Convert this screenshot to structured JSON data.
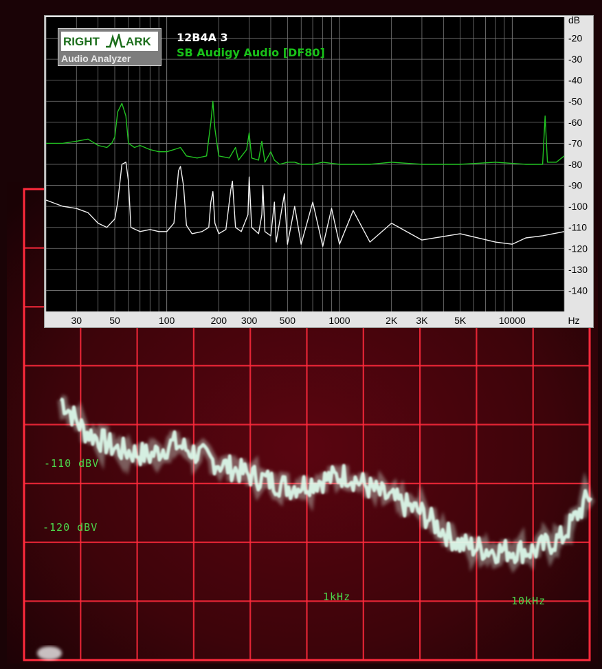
{
  "scope_overlay": {
    "labels": [
      {
        "text": "-110 dBV",
        "name": "scope-label-110dbv"
      },
      {
        "text": "-120 dBV",
        "name": "scope-label-120dbv"
      },
      {
        "text": "1kHz",
        "name": "scope-label-1khz"
      },
      {
        "text": "10kHz",
        "name": "scope-label-10khz"
      }
    ],
    "colors": {
      "background": "#3a0408",
      "grid": "#ff2a3c",
      "trace": "#dffff0",
      "label": "#4cd94c"
    }
  },
  "rmaa": {
    "logo": {
      "word1": "RIGHT",
      "word2": "ARK",
      "subtitle": "Audio Analyzer"
    },
    "title_line1": "12B4A 3",
    "title_line2": "SB Audigy Audio [DF80]",
    "colors": {
      "plot_bg": "#000000",
      "grid": "#7a7a7a",
      "series_green": "#22c422",
      "series_white": "#f0f0f0",
      "panel": "#e4e4e4"
    }
  },
  "chart_data": {
    "type": "line",
    "title": "12B4A 3",
    "subtitle": "SB Audigy Audio [DF80]",
    "xlabel": "Hz",
    "ylabel": "dB",
    "x_scale": "log",
    "xlim": [
      20,
      20000
    ],
    "ylim": [
      -150,
      -10
    ],
    "x_tick_labels": [
      "30",
      "50",
      "100",
      "200",
      "300",
      "500",
      "1000",
      "2K",
      "3K",
      "5K",
      "10000",
      "Hz"
    ],
    "x_tick_values": [
      30,
      50,
      100,
      200,
      300,
      500,
      1000,
      2000,
      3000,
      5000,
      10000
    ],
    "y_tick_labels": [
      "dB",
      "-20",
      "-30",
      "-40",
      "-50",
      "-60",
      "-70",
      "-80",
      "-90",
      "-100",
      "-110",
      "-120",
      "-130",
      "-140"
    ],
    "y_tick_values": [
      -20,
      -30,
      -40,
      -50,
      -60,
      -70,
      -80,
      -90,
      -100,
      -110,
      -120,
      -130,
      -140
    ],
    "grid": true,
    "series": [
      {
        "name": "SB Audigy Audio [DF80]",
        "color": "#22c422",
        "points": [
          [
            20,
            -70
          ],
          [
            25,
            -70
          ],
          [
            30,
            -69
          ],
          [
            35,
            -68
          ],
          [
            40,
            -71
          ],
          [
            45,
            -72
          ],
          [
            48,
            -70
          ],
          [
            50,
            -67
          ],
          [
            52,
            -55
          ],
          [
            55,
            -51
          ],
          [
            58,
            -57
          ],
          [
            60,
            -70
          ],
          [
            65,
            -72
          ],
          [
            70,
            -71
          ],
          [
            80,
            -73
          ],
          [
            90,
            -74
          ],
          [
            100,
            -74
          ],
          [
            110,
            -73
          ],
          [
            120,
            -72
          ],
          [
            125,
            -74
          ],
          [
            130,
            -76
          ],
          [
            150,
            -77
          ],
          [
            170,
            -76
          ],
          [
            180,
            -60
          ],
          [
            185,
            -50
          ],
          [
            190,
            -63
          ],
          [
            200,
            -76
          ],
          [
            230,
            -77
          ],
          [
            250,
            -72
          ],
          [
            260,
            -78
          ],
          [
            290,
            -73
          ],
          [
            300,
            -65
          ],
          [
            310,
            -77
          ],
          [
            340,
            -78
          ],
          [
            355,
            -69
          ],
          [
            370,
            -79
          ],
          [
            400,
            -74
          ],
          [
            420,
            -78
          ],
          [
            450,
            -80
          ],
          [
            500,
            -79
          ],
          [
            550,
            -79
          ],
          [
            600,
            -80
          ],
          [
            700,
            -80
          ],
          [
            800,
            -79
          ],
          [
            1000,
            -80
          ],
          [
            1500,
            -80
          ],
          [
            2000,
            -79
          ],
          [
            3000,
            -80
          ],
          [
            5000,
            -80
          ],
          [
            8000,
            -79
          ],
          [
            12000,
            -80
          ],
          [
            15000,
            -80
          ],
          [
            15500,
            -57
          ],
          [
            16000,
            -79
          ],
          [
            18000,
            -79
          ],
          [
            20000,
            -76
          ]
        ]
      },
      {
        "name": "12B4A 3",
        "color": "#f0f0f0",
        "points": [
          [
            20,
            -97
          ],
          [
            25,
            -100
          ],
          [
            30,
            -101
          ],
          [
            35,
            -103
          ],
          [
            40,
            -108
          ],
          [
            45,
            -110
          ],
          [
            50,
            -106
          ],
          [
            52,
            -98
          ],
          [
            55,
            -80
          ],
          [
            58,
            -79
          ],
          [
            60,
            -88
          ],
          [
            62,
            -110
          ],
          [
            70,
            -112
          ],
          [
            80,
            -111
          ],
          [
            90,
            -112
          ],
          [
            100,
            -112
          ],
          [
            110,
            -108
          ],
          [
            117,
            -83
          ],
          [
            120,
            -81
          ],
          [
            125,
            -90
          ],
          [
            130,
            -109
          ],
          [
            140,
            -113
          ],
          [
            160,
            -112
          ],
          [
            175,
            -110
          ],
          [
            180,
            -98
          ],
          [
            185,
            -93
          ],
          [
            190,
            -108
          ],
          [
            200,
            -113
          ],
          [
            220,
            -111
          ],
          [
            235,
            -92
          ],
          [
            240,
            -88
          ],
          [
            250,
            -110
          ],
          [
            270,
            -112
          ],
          [
            295,
            -104
          ],
          [
            300,
            -86
          ],
          [
            310,
            -110
          ],
          [
            340,
            -113
          ],
          [
            355,
            -104
          ],
          [
            360,
            -90
          ],
          [
            370,
            -112
          ],
          [
            400,
            -114
          ],
          [
            420,
            -98
          ],
          [
            430,
            -117
          ],
          [
            480,
            -94
          ],
          [
            500,
            -118
          ],
          [
            550,
            -100
          ],
          [
            600,
            -118
          ],
          [
            700,
            -98
          ],
          [
            800,
            -119
          ],
          [
            900,
            -101
          ],
          [
            1000,
            -118
          ],
          [
            1200,
            -102
          ],
          [
            1500,
            -117
          ],
          [
            2000,
            -108
          ],
          [
            3000,
            -116
          ],
          [
            5000,
            -113
          ],
          [
            8000,
            -117
          ],
          [
            10000,
            -118
          ],
          [
            12000,
            -115
          ],
          [
            15000,
            -114
          ],
          [
            20000,
            -112
          ]
        ]
      },
      {
        "name": "",
        "color": "#dffff0",
        "points": [
          [
            30,
            -100
          ],
          [
            40,
            -105
          ],
          [
            60,
            -108
          ],
          [
            90,
            -109
          ],
          [
            120,
            -107
          ],
          [
            200,
            -110
          ],
          [
            300,
            -112
          ],
          [
            500,
            -114
          ],
          [
            700,
            -113
          ],
          [
            1000,
            -112
          ],
          [
            1500,
            -115
          ],
          [
            2500,
            -118
          ],
          [
            4000,
            -123
          ],
          [
            6000,
            -124
          ],
          [
            10000,
            -124
          ],
          [
            14000,
            -122
          ],
          [
            20000,
            -115
          ]
        ]
      }
    ]
  }
}
